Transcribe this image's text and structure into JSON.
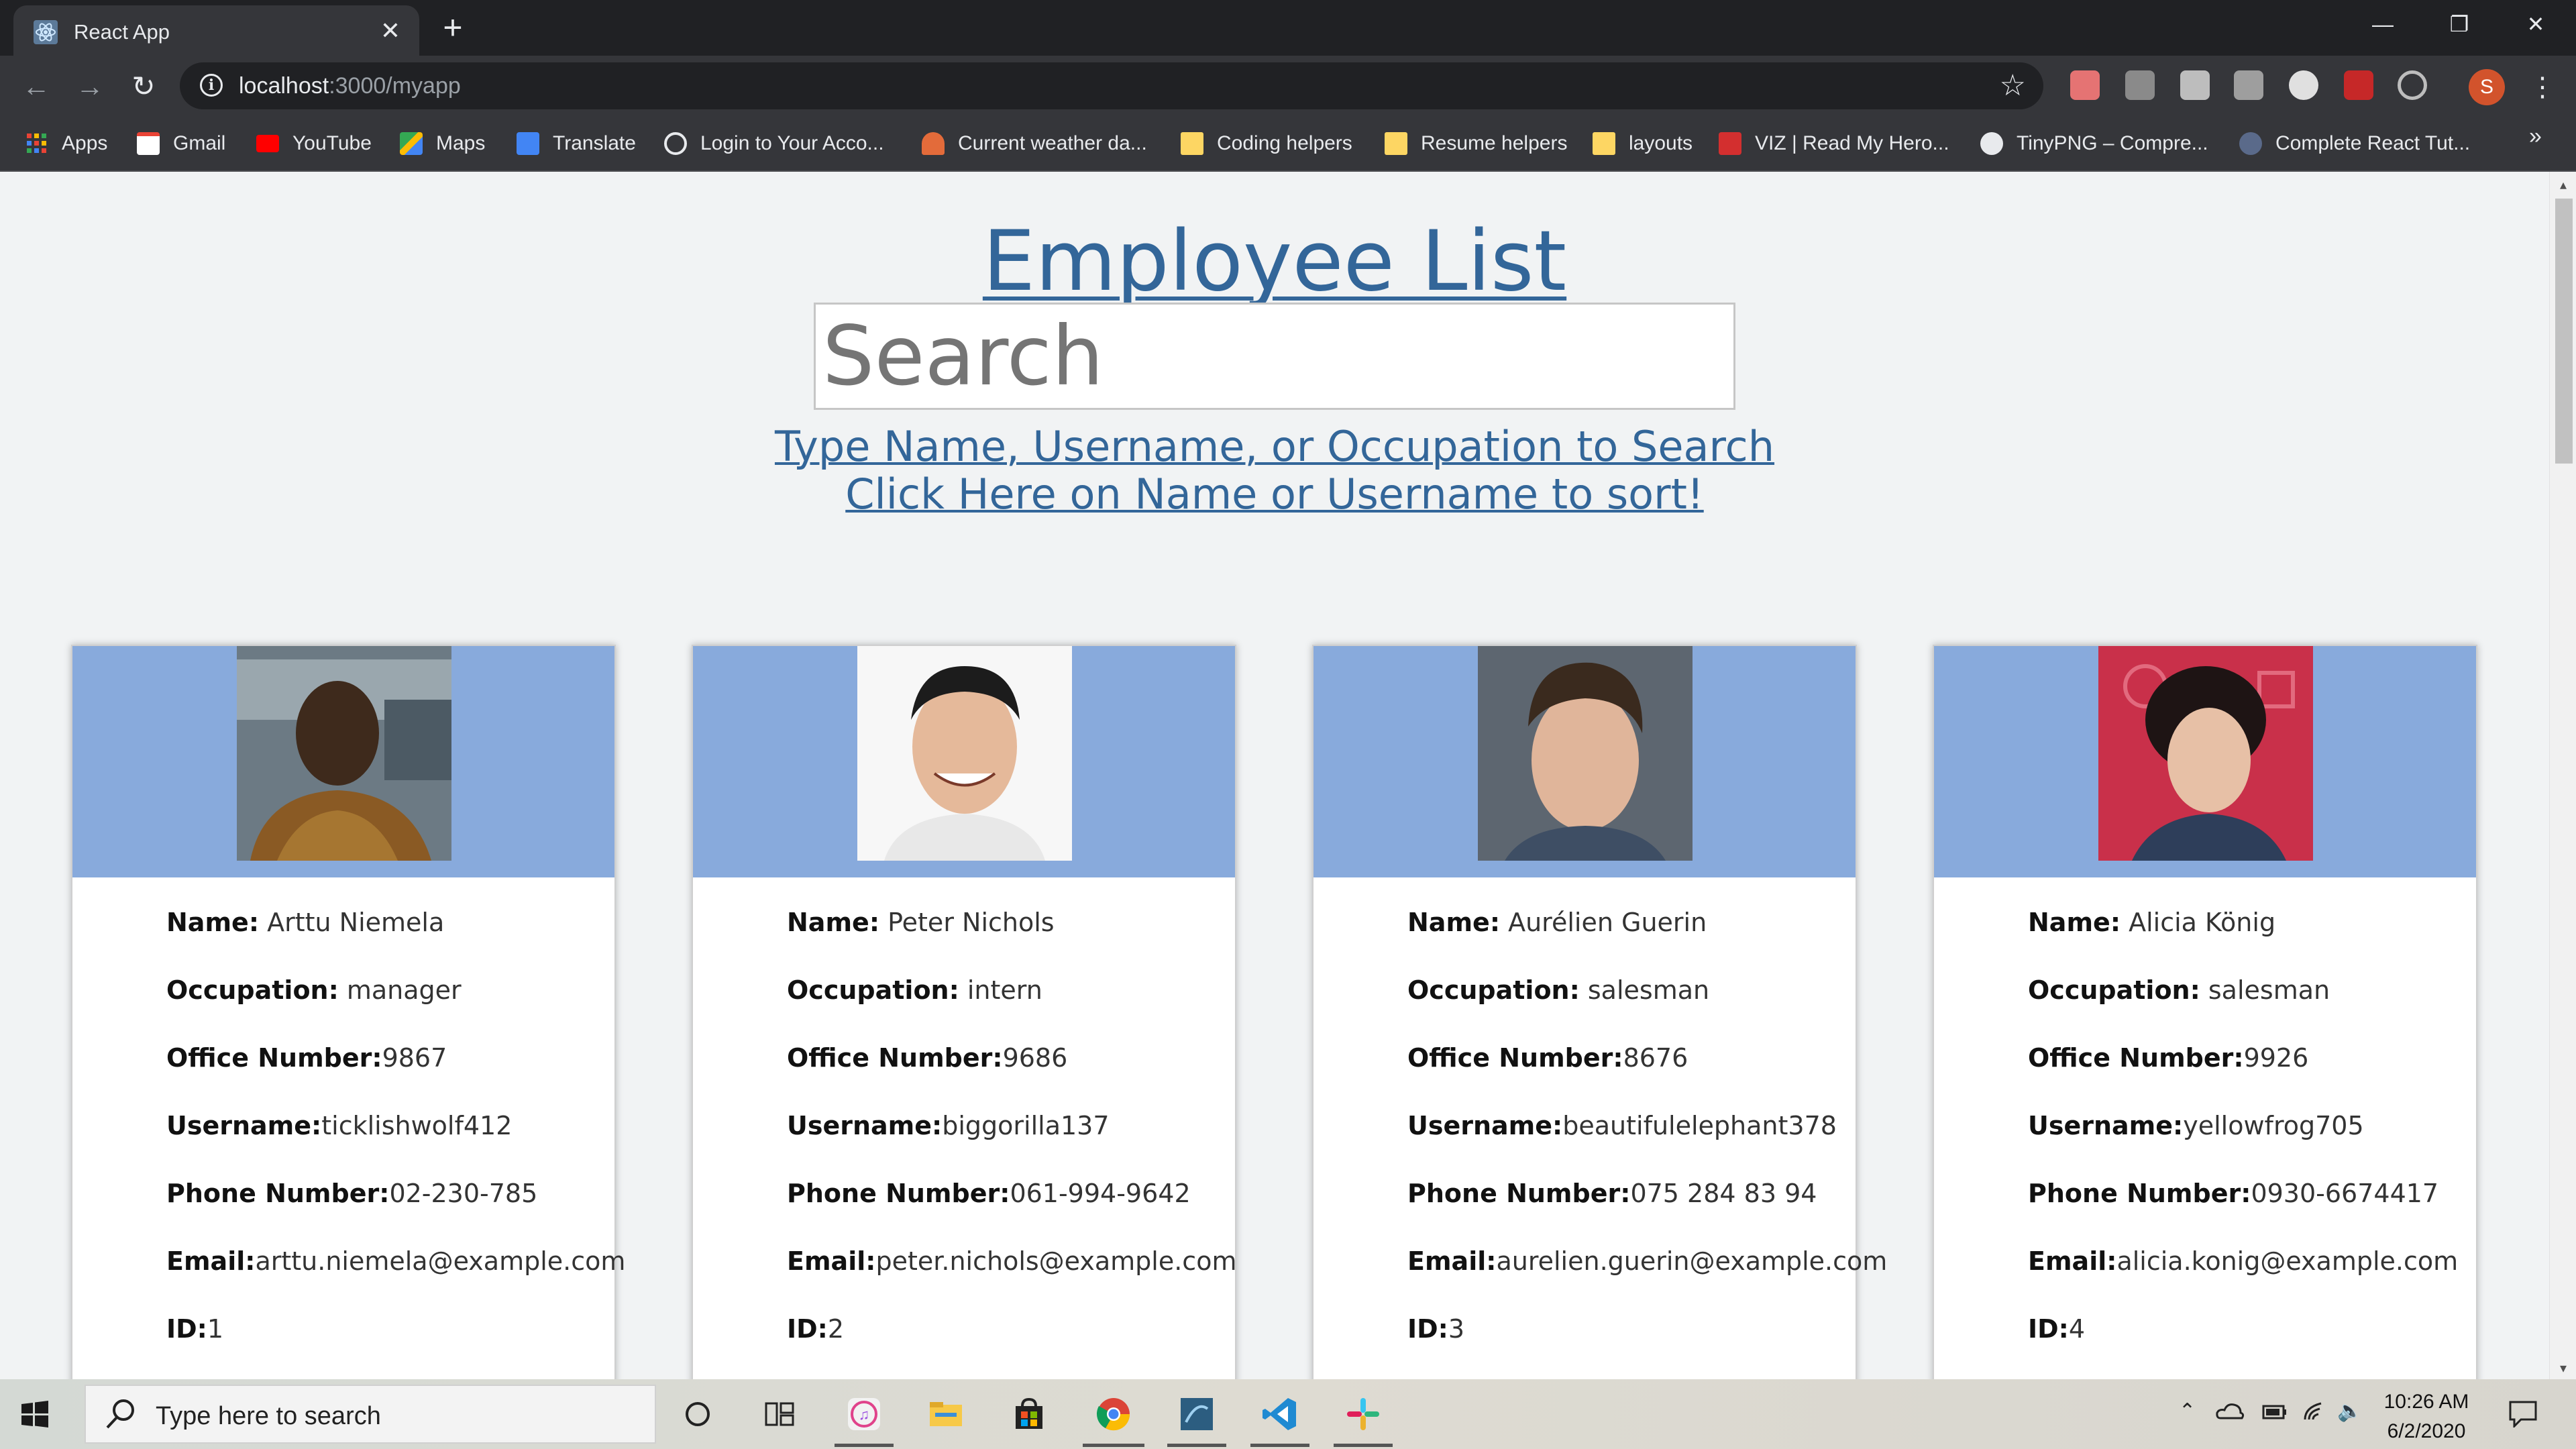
{
  "browser": {
    "tab": {
      "title": "React App",
      "close": "✕",
      "favicon": "react-icon"
    },
    "newtab": "+",
    "window": {
      "minimize": "—",
      "restore": "❐",
      "close": "✕"
    },
    "url": {
      "host": "localhost",
      "path": ":3000/myapp"
    },
    "profile_initial": "S",
    "menu": "⋮",
    "bookmarks": [
      {
        "label": "Apps",
        "icon": "apps-grid-icon"
      },
      {
        "label": "Gmail",
        "icon": "gmail-icon"
      },
      {
        "label": "YouTube",
        "icon": "youtube-icon"
      },
      {
        "label": "Maps",
        "icon": "maps-icon"
      },
      {
        "label": "Translate",
        "icon": "translate-icon"
      },
      {
        "label": "Login to Your Acco...",
        "icon": "globe-icon"
      },
      {
        "label": "Current weather da...",
        "icon": "weather-icon"
      },
      {
        "label": "Coding helpers",
        "icon": "folder-icon"
      },
      {
        "label": "Resume helpers",
        "icon": "folder-icon"
      },
      {
        "label": "layouts",
        "icon": "folder-icon"
      },
      {
        "label": "VIZ | Read My Hero...",
        "icon": "viz-icon"
      },
      {
        "label": "TinyPNG – Compre...",
        "icon": "panda-icon"
      },
      {
        "label": "Complete React Tut...",
        "icon": "dc-icon"
      }
    ],
    "bookmarks_more": "»"
  },
  "page": {
    "title": "Employee List",
    "search_placeholder": "Search",
    "hint_search": "Type Name, Username, or Occupation to Search",
    "hint_sort": "Click Here on Name or Username to sort!",
    "labels": {
      "name": "Name:",
      "occupation": "Occupation:",
      "office": "Office Number:",
      "username": "Username:",
      "phone": "Phone Number:",
      "email": "Email:",
      "id": "ID:"
    },
    "employees": [
      {
        "name": " Arttu Niemela",
        "occupation": " manager",
        "office": "9867",
        "username": "ticklishwolf412",
        "phone": "02-230-785",
        "email": "arttu.niemela@example.com",
        "id": "1"
      },
      {
        "name": " Peter Nichols",
        "occupation": " intern",
        "office": "9686",
        "username": "biggorilla137",
        "phone": "061-994-9642",
        "email": "peter.nichols@example.com",
        "id": "2"
      },
      {
        "name": " Aurélien Guerin",
        "occupation": " salesman",
        "office": "8676",
        "username": "beautifulelephant378",
        "phone": "075 284 83 94",
        "email": "aurelien.guerin@example.com",
        "id": "3"
      },
      {
        "name": " Alicia König",
        "occupation": " salesman",
        "office": "9926",
        "username": "yellowfrog705",
        "phone": "0930-6674417",
        "email": "alicia.konig@example.com",
        "id": "4"
      }
    ]
  },
  "taskbar": {
    "search_placeholder": "Type here to search",
    "time": "10:26 AM",
    "date": "6/2/2020",
    "pinned": [
      "cortana-icon",
      "task-view-icon",
      "itunes-icon",
      "file-explorer-icon",
      "store-icon",
      "chrome-icon",
      "mysql-workbench-icon",
      "vscode-icon",
      "slack-icon"
    ]
  },
  "colors": {
    "link": "#336699",
    "card_banner": "#88aadc",
    "chrome_dark": "#202124",
    "chrome_toolbar": "#35363a"
  }
}
